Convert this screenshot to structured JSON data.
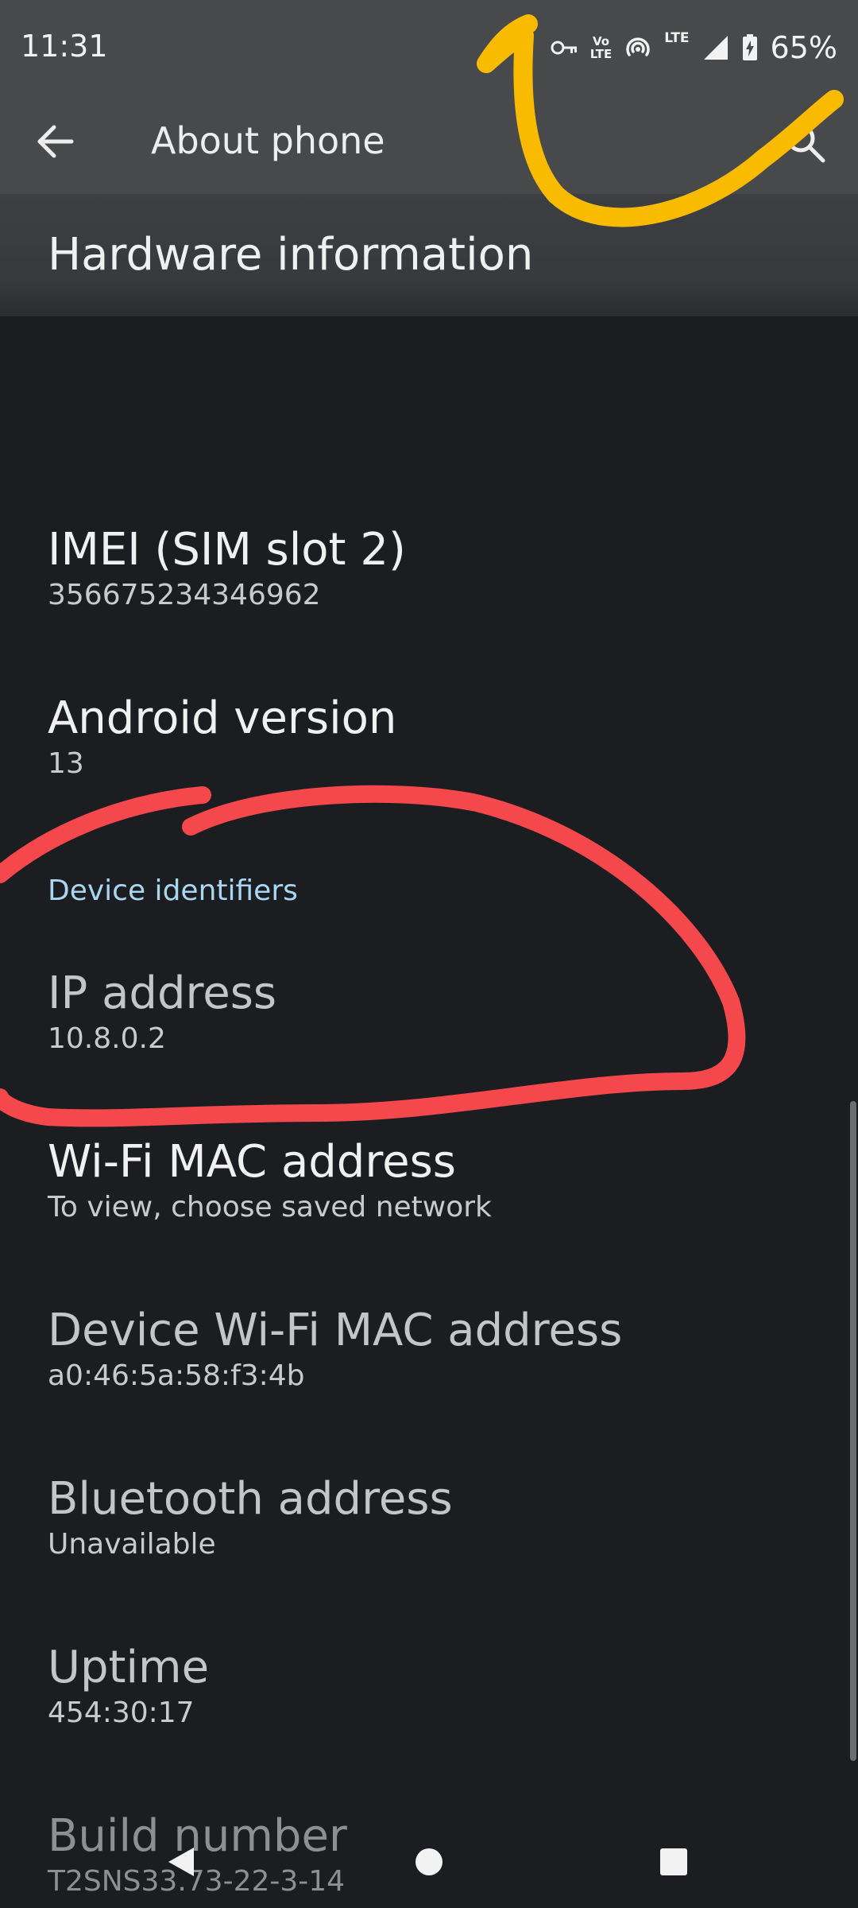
{
  "status_bar": {
    "time": "11:31",
    "volte_top": "Vo",
    "volte_bottom": "LTE",
    "lte": "LTE",
    "battery": "65%",
    "icons": [
      "vpn-key-icon",
      "volte-icon",
      "hotspot-icon",
      "lte-icon",
      "signal-icon",
      "battery-charging-icon"
    ]
  },
  "app_bar": {
    "title": "About phone",
    "back_icon": "arrow-back-icon",
    "search_icon": "search-icon"
  },
  "section": {
    "title": "Hardware information"
  },
  "items": [
    {
      "title": "IMEI (SIM slot 2)",
      "value": "356675234346962"
    },
    {
      "title": "Android version",
      "value": "13"
    },
    {
      "title": "IP address",
      "value": "10.8.0.2"
    },
    {
      "title": "Wi-Fi MAC address",
      "value": "To view, choose saved network"
    },
    {
      "title": "Device Wi-Fi MAC address",
      "value": "a0:46:5a:58:f3:4b"
    },
    {
      "title": "Bluetooth address",
      "value": "Unavailable"
    },
    {
      "title": "Uptime",
      "value": "454:30:17"
    },
    {
      "title": "Build number",
      "value": "T2SNS33.73-22-3-14"
    }
  ],
  "category": "Device identifiers",
  "annotations": {
    "yellow_stroke_color": "#f8bb00",
    "red_stroke_color": "#f4484c"
  },
  "nav_bar": {
    "icons": [
      "back-triangle-icon",
      "home-circle-icon",
      "recents-square-icon"
    ]
  }
}
